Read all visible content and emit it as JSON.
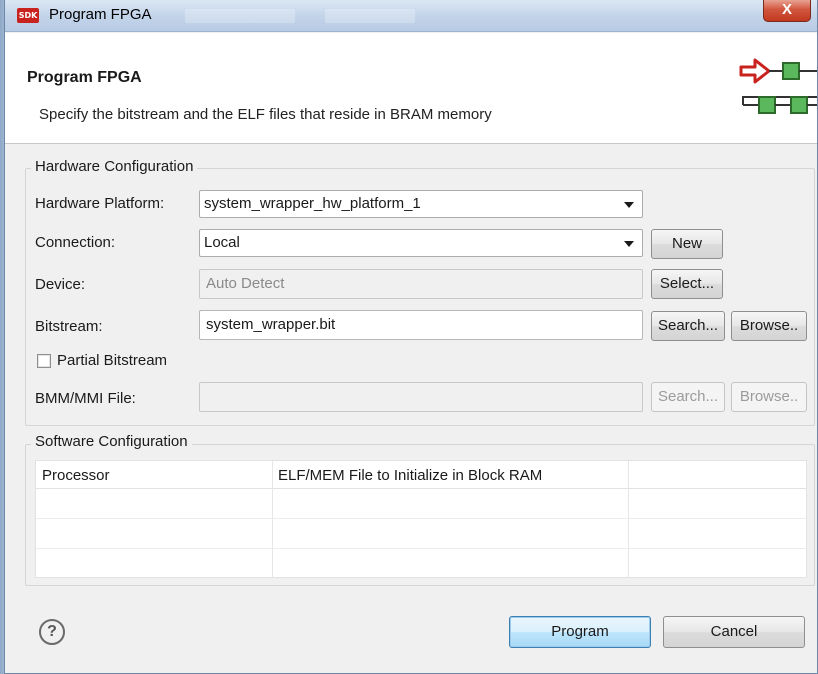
{
  "window": {
    "app_icon_text": "SDK",
    "title": "Program FPGA",
    "close_label": "X"
  },
  "header": {
    "title": "Program FPGA",
    "description": "Specify the bitstream and the ELF files that reside in BRAM memory",
    "graphic": "fpga-program-graphic-icon"
  },
  "hardware": {
    "group_label": "Hardware Configuration",
    "platform_label": "Hardware Platform:",
    "platform_value": "system_wrapper_hw_platform_1",
    "connection_label": "Connection:",
    "connection_value": "Local",
    "new_label": "New",
    "device_label": "Device:",
    "device_value": "Auto Detect",
    "select_label": "Select...",
    "bitstream_label": "Bitstream:",
    "bitstream_value": "system_wrapper.bit",
    "search_label": "Search...",
    "browse_label": "Browse..",
    "partial_label": "Partial Bitstream",
    "partial_checked": false,
    "bmm_label": "BMM/MMI File:",
    "bmm_value": "",
    "bmm_search_label": "Search...",
    "bmm_browse_label": "Browse.."
  },
  "software": {
    "group_label": "Software Configuration",
    "columns": [
      "Processor",
      "ELF/MEM File to Initialize in Block RAM",
      ""
    ],
    "rows": []
  },
  "footer": {
    "help_glyph": "?",
    "program_label": "Program",
    "cancel_label": "Cancel"
  },
  "colors": {
    "close_button": "#c0391f",
    "window_bg": "#f0f0f0",
    "accent_red": "#c8231e",
    "accent_green": "#5cb85c"
  }
}
